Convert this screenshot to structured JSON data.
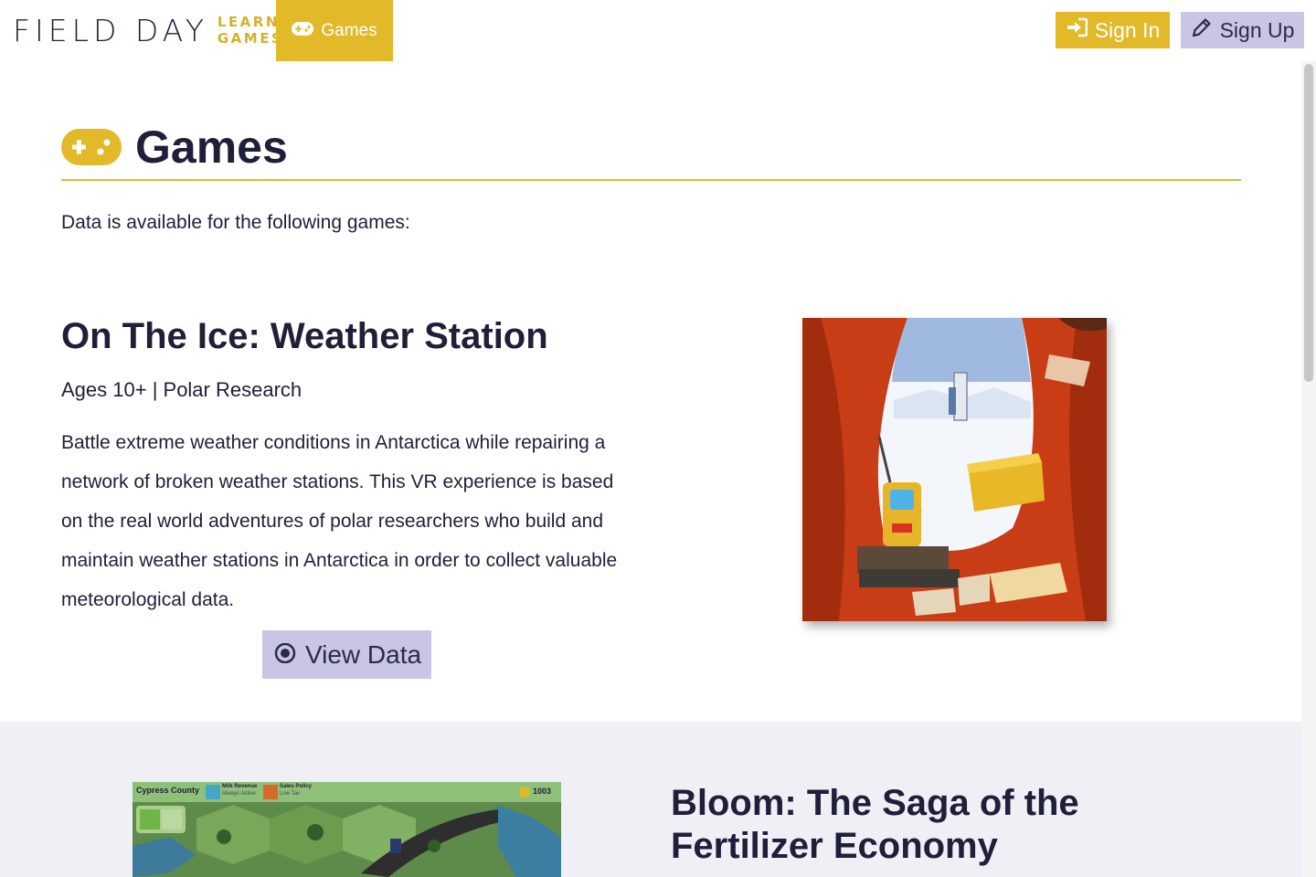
{
  "header": {
    "logo_main": "FIELD DAY",
    "logo_sub_1": "LEARNING",
    "logo_sub_2": "GAMES",
    "nav_games_label": "Games",
    "sign_in_label": "Sign In",
    "sign_up_label": "Sign Up"
  },
  "page": {
    "title": "Games",
    "intro": "Data is available for the following games:"
  },
  "games": [
    {
      "title": "On The Ice: Weather Station",
      "meta": "Ages 10+ | Polar Research",
      "description": "Battle extreme weather conditions in Antarctica while repairing a network of broken weather stations. This VR experience is based on the real world adventures of polar researchers who build and maintain weather stations in Antarctica in order to collect valuable meteorological data.",
      "button_label": "View Data"
    },
    {
      "title": "Bloom: The Saga of the Fertilizer Economy",
      "hud_county": "Cypress County",
      "hud_milk_title": "Milk Revenue",
      "hud_milk_sub": "Always Active",
      "hud_sales_title": "Sales Policy",
      "hud_sales_sub": "Low Tax",
      "hud_coins": "1003"
    }
  ],
  "colors": {
    "accent_yellow": "#e2b928",
    "accent_lavender": "#c8c6e2",
    "text_dark": "#1f1f3a",
    "section_bg": "#f0eff5"
  },
  "icons": {
    "nav_games": "gamepad-icon",
    "sign_in": "sign-in-icon",
    "sign_up": "pencil-icon",
    "title": "gamepad-icon",
    "view_data": "eye-icon"
  }
}
